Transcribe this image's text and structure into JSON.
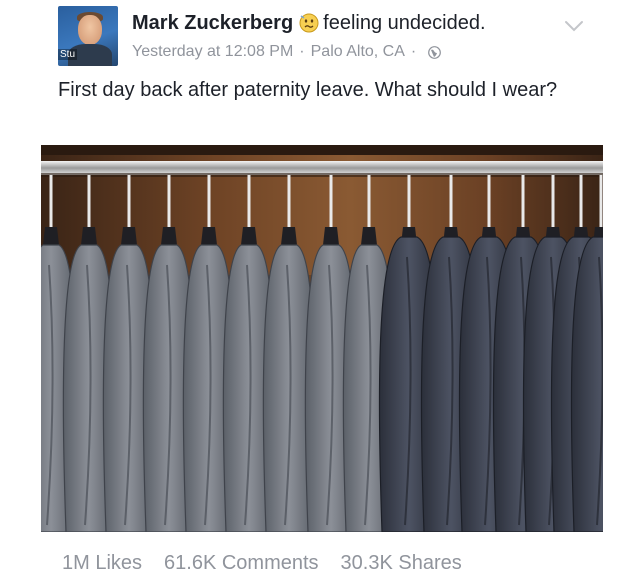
{
  "post": {
    "author": "Mark Zuckerberg",
    "feeling": "feeling undecided.",
    "feeling_icon": "undecided-emoji-icon",
    "timestamp": "Yesterday at 12:08 PM",
    "location": "Palo Alto, CA",
    "separator": "·",
    "privacy_icon": "public-globe-icon",
    "menu_icon": "chevron-down-icon",
    "text": "First day back after paternity leave. What should I wear?",
    "avatar_watermark": "Stu",
    "photo_subject": "closet-rack-of-gray-t-shirts-and-hoodies"
  },
  "stats": {
    "likes": "1M Likes",
    "comments": "61.6K Comments",
    "shares": "30.3K Shares"
  },
  "colors": {
    "text": "#1d2129",
    "muted": "#90949c",
    "accent": "#3b78bd"
  }
}
